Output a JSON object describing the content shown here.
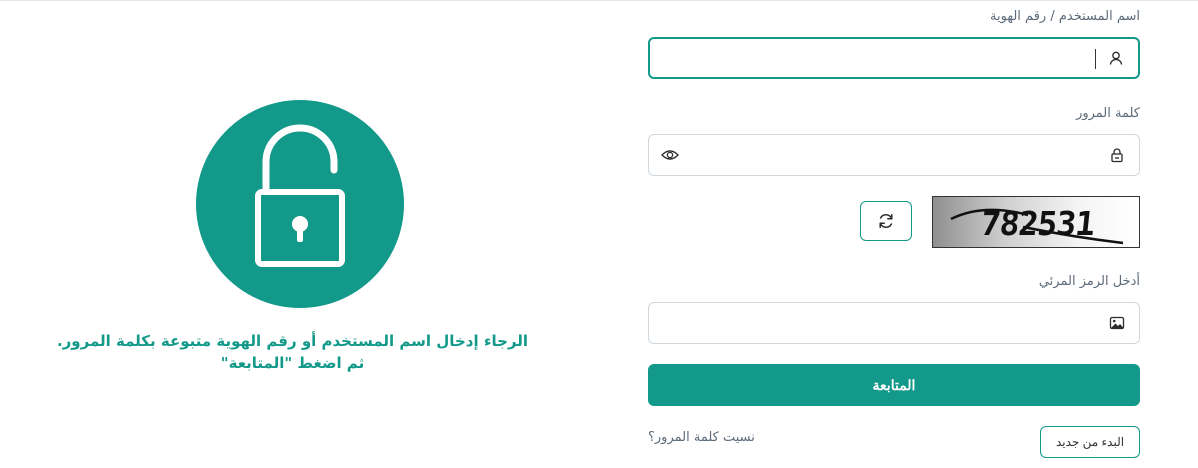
{
  "form": {
    "username_label": "اسم المستخدم / رقم الهوية",
    "username_value": "",
    "username_placeholder": "",
    "password_label": "كلمة المرور",
    "password_value": "",
    "password_placeholder": "",
    "captcha_text": "782531",
    "captcha_input_label": "أدخل الرمز المرئي",
    "captcha_input_value": "",
    "continue_label": "المتابعة",
    "restart_label": "البدء من جديد",
    "forgot_password_label": "نسيت كلمة المرور؟"
  },
  "instructions": {
    "line1": "الرجاء إدخال اسم المستخدم أو رقم الهوية متبوعة بكلمة المرور.",
    "line2": "ثم اضغط \"المتابعة\""
  },
  "colors": {
    "accent": "#13998a",
    "border": "#cfd6dc",
    "label_text": "#5c6b7a"
  },
  "icons": {
    "username": "user-icon",
    "password": "lock-icon",
    "password_toggle": "eye-icon",
    "captcha_refresh": "refresh-icon",
    "captcha_input": "image-icon",
    "illustration": "unlocked-padlock-icon"
  }
}
